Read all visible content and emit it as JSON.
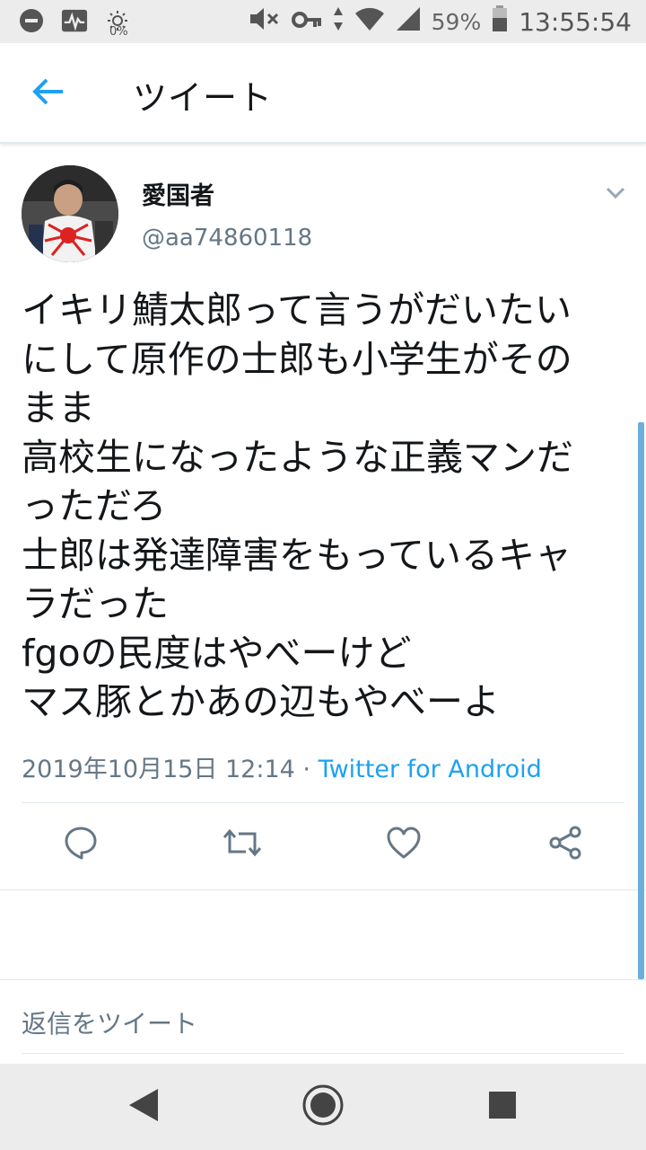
{
  "status_bar": {
    "battery_percent": "59%",
    "time": "13:55:54",
    "dnd_percent": "0%",
    "icons": [
      "dnd-icon",
      "activity-icon",
      "brightness-icon",
      "mute-icon",
      "key-icon",
      "data-arrows-icon",
      "wifi-icon",
      "signal-icon",
      "battery-icon"
    ]
  },
  "header": {
    "title": "ツイート",
    "back_icon": "back-arrow-icon"
  },
  "tweet": {
    "author_name": "愛国者",
    "author_handle": "@aa74860118",
    "text_lines": [
      "イキリ鯖太郎って言うがだいたい",
      "にして原作の士郎も小学生がその",
      "まま",
      "高校生になったような正義マンだ",
      "っただろ",
      "士郎は発達障害をもっているキャ",
      "ラだった",
      "fgoの民度はやべーけど",
      "マス豚とかあの辺もやべーよ"
    ],
    "timestamp": "2019年10月15日 12:14",
    "separator": " · ",
    "source": "Twitter for Android"
  },
  "actions": {
    "icons": [
      "reply-icon",
      "retweet-icon",
      "like-icon",
      "share-icon"
    ]
  },
  "reply": {
    "placeholder": "返信をツイート"
  },
  "colors": {
    "accent": "#1da1f2",
    "secondary_text": "#657786",
    "primary_text": "#14171a",
    "divider": "#e1e8ed"
  }
}
